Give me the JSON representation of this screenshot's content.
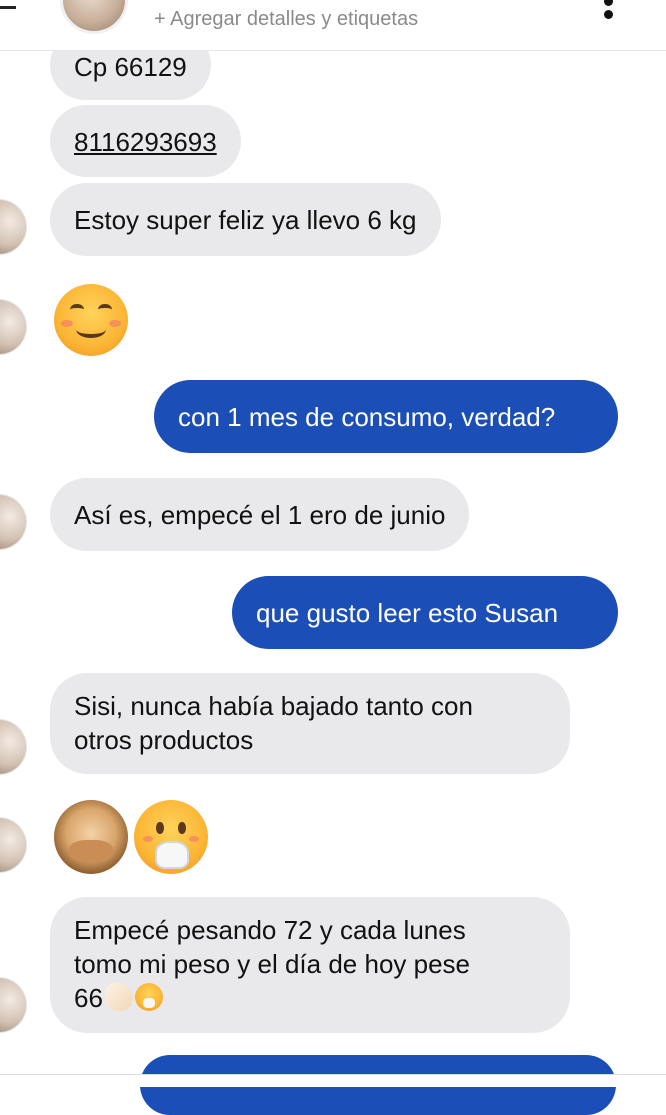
{
  "header": {
    "subtitle": "+ Agregar detalles y etiquetas",
    "menu_icon": "more-vertical-icon"
  },
  "messages": [
    {
      "id": "m1",
      "side": "in",
      "text": "Cp 66129"
    },
    {
      "id": "m2",
      "side": "in",
      "text": "8116293693",
      "is_phone_link": true
    },
    {
      "id": "m3",
      "side": "in",
      "text": "Estoy super feliz ya llevo 6 kg"
    },
    {
      "id": "m4",
      "side": "in",
      "type": "emoji",
      "emoji": [
        "smiling-face-with-smiling-eyes"
      ]
    },
    {
      "id": "m5",
      "side": "out",
      "text": "con 1 mes de consumo, verdad?"
    },
    {
      "id": "m6",
      "side": "in",
      "text": "Así es, empecé el 1 ero de junio"
    },
    {
      "id": "m7",
      "side": "out",
      "text": "que gusto leer esto Susan"
    },
    {
      "id": "m8",
      "side": "in",
      "lines": [
        "Sisi, nunca había bajado tanto con",
        "otros productos"
      ]
    },
    {
      "id": "m9",
      "side": "in",
      "type": "emoji",
      "emoji": [
        "see-no-evil-monkey",
        "face-with-hand-over-mouth"
      ]
    },
    {
      "id": "m10",
      "side": "in",
      "lines": [
        "Empecé pesando 72 y cada lunes",
        "tomo mi peso y el día de hoy pese",
        "66"
      ],
      "trailing_emoji": [
        "flexed-biceps",
        "face-with-hand-over-mouth"
      ]
    }
  ],
  "colors": {
    "incoming_bubble": "#e9e9eb",
    "outgoing_bubble": "#1b4fb7",
    "outgoing_text": "#ffffff",
    "incoming_text": "#111111",
    "subtitle_text": "#8a8a8a"
  }
}
